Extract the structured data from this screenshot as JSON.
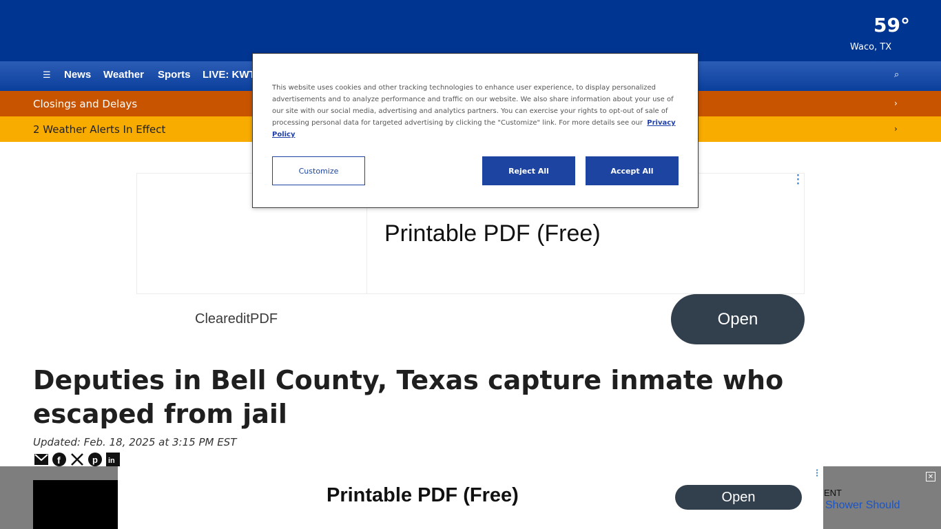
{
  "weather": {
    "temp": "59°",
    "location": "Waco, TX"
  },
  "nav": {
    "menu_icon": "menu-icon",
    "items": [
      "News",
      "Weather",
      "Sports",
      "LIVE: KWT"
    ],
    "right_icon": "search-icon"
  },
  "closings": {
    "label": "Closings and Delays",
    "icon": "chevron-icon"
  },
  "alerts": {
    "label": "2 Weather Alerts In Effect",
    "icon": "chevron-icon"
  },
  "ad": {
    "headline": "Printable PDF (Free)",
    "brand": "CleareditPDF",
    "open_label": "Open",
    "menu_icon": "more-options-icon"
  },
  "article": {
    "headline": "Deputies in Bell County, Texas capture inmate who escaped from jail",
    "updated": "Updated: Feb. 18, 2025 at 3:15 PM EST",
    "share_icons": [
      "email-icon",
      "facebook-icon",
      "x-icon",
      "pinterest-icon",
      "linkedin-icon"
    ]
  },
  "bottom_ad": {
    "headline": "Printable PDF (Free)",
    "open_label": "Open",
    "side_text_1": "ENT",
    "side_text_2": "Shower Should",
    "close_icon": "close-icon"
  },
  "consent": {
    "text": "This website uses cookies and other tracking technologies to enhance user experience, to display personalized advertisements and to analyze performance and traffic on our website. We also share information about your use of our site with our social media, advertising and analytics partners. You can exercise your rights to opt-out of sale of processing personal data for targeted advertising by clicking the \"Customize\" link. For more details see our",
    "link": "Privacy Policy",
    "customize_label": "Customize",
    "reject_label": "Reject All",
    "accept_label": "Accept All"
  },
  "colors": {
    "header_blue": "#003591",
    "closings_orange": "#c85400",
    "alerts_yellow": "#f9ac00",
    "button_blue": "#1d44a0",
    "open_button": "#323f4d"
  }
}
